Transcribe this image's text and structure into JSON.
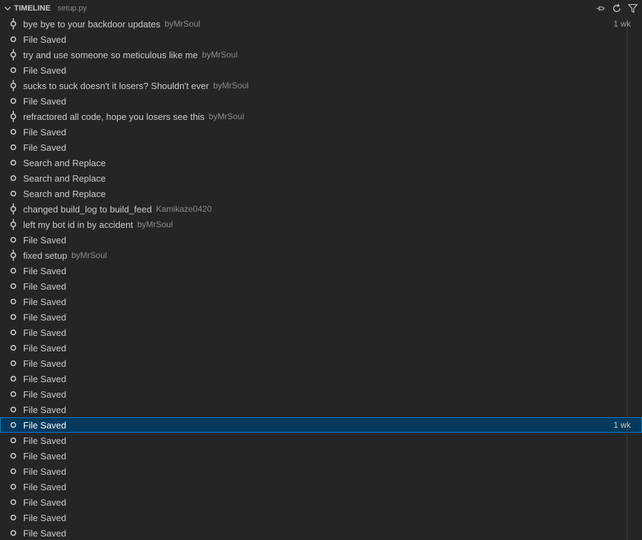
{
  "header": {
    "title": "TIMELINE",
    "description": "setup.py",
    "actions": [
      "pin-icon",
      "refresh-icon",
      "filter-icon"
    ]
  },
  "colors": {
    "background": "#252526",
    "selected_background": "#04395e",
    "selected_border": "#007fd4",
    "text": "#cccccc",
    "description": "#8b8b8b"
  },
  "items": [
    {
      "label": "bye bye to your backdoor updates",
      "author": "byMrSoul",
      "time": "1 wk",
      "kind": "commit"
    },
    {
      "label": "File Saved",
      "author": "",
      "time": "",
      "kind": "save"
    },
    {
      "label": "try and use someone so meticulous like me",
      "author": "byMrSoul",
      "time": "",
      "kind": "commit"
    },
    {
      "label": "File Saved",
      "author": "",
      "time": "",
      "kind": "save"
    },
    {
      "label": "sucks to suck doesn't it losers? Shouldn't ever",
      "author": "byMrSoul",
      "time": "",
      "kind": "commit"
    },
    {
      "label": "File Saved",
      "author": "",
      "time": "",
      "kind": "save"
    },
    {
      "label": "refractored all code, hope you losers see this",
      "author": "byMrSoul",
      "time": "",
      "kind": "commit"
    },
    {
      "label": "File Saved",
      "author": "",
      "time": "",
      "kind": "save"
    },
    {
      "label": "File Saved",
      "author": "",
      "time": "",
      "kind": "save"
    },
    {
      "label": "Search and Replace",
      "author": "",
      "time": "",
      "kind": "save"
    },
    {
      "label": "Search and Replace",
      "author": "",
      "time": "",
      "kind": "save"
    },
    {
      "label": "Search and Replace",
      "author": "",
      "time": "",
      "kind": "save"
    },
    {
      "label": "changed build_log to build_feed",
      "author": "Kamikaze0420",
      "time": "",
      "kind": "commit"
    },
    {
      "label": "left my bot id in by accident",
      "author": "byMrSoul",
      "time": "",
      "kind": "commit"
    },
    {
      "label": "File Saved",
      "author": "",
      "time": "",
      "kind": "save"
    },
    {
      "label": "fixed setup",
      "author": "byMrSoul",
      "time": "",
      "kind": "commit"
    },
    {
      "label": "File Saved",
      "author": "",
      "time": "",
      "kind": "save"
    },
    {
      "label": "File Saved",
      "author": "",
      "time": "",
      "kind": "save"
    },
    {
      "label": "File Saved",
      "author": "",
      "time": "",
      "kind": "save"
    },
    {
      "label": "File Saved",
      "author": "",
      "time": "",
      "kind": "save"
    },
    {
      "label": "File Saved",
      "author": "",
      "time": "",
      "kind": "save"
    },
    {
      "label": "File Saved",
      "author": "",
      "time": "",
      "kind": "save"
    },
    {
      "label": "File Saved",
      "author": "",
      "time": "",
      "kind": "save"
    },
    {
      "label": "File Saved",
      "author": "",
      "time": "",
      "kind": "save"
    },
    {
      "label": "File Saved",
      "author": "",
      "time": "",
      "kind": "save"
    },
    {
      "label": "File Saved",
      "author": "",
      "time": "",
      "kind": "save"
    },
    {
      "label": "File Saved",
      "author": "",
      "time": "1 wk",
      "kind": "save",
      "selected": true
    },
    {
      "label": "File Saved",
      "author": "",
      "time": "",
      "kind": "save"
    },
    {
      "label": "File Saved",
      "author": "",
      "time": "",
      "kind": "save"
    },
    {
      "label": "File Saved",
      "author": "",
      "time": "",
      "kind": "save"
    },
    {
      "label": "File Saved",
      "author": "",
      "time": "",
      "kind": "save"
    },
    {
      "label": "File Saved",
      "author": "",
      "time": "",
      "kind": "save"
    },
    {
      "label": "File Saved",
      "author": "",
      "time": "",
      "kind": "save"
    },
    {
      "label": "File Saved",
      "author": "",
      "time": "",
      "kind": "save"
    }
  ]
}
